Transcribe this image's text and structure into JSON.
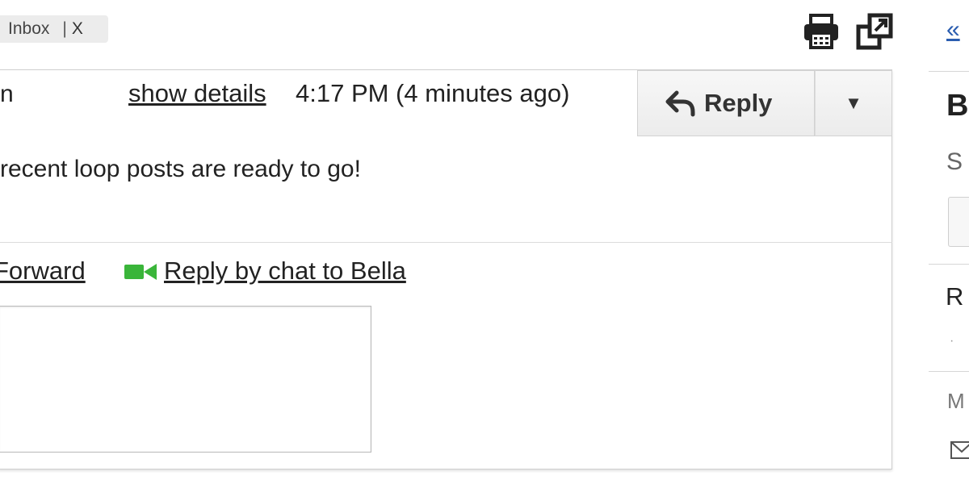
{
  "label": {
    "name": "Inbox",
    "separator": "|",
    "remove": "X"
  },
  "toolbar": {
    "print_icon": "printer-icon",
    "new_window_icon": "new-window-icon",
    "back_link": "«"
  },
  "message": {
    "sender_fragment": "n",
    "show_details": "show details",
    "timestamp": "4:17 PM (4 minutes ago)",
    "reply_label": "Reply",
    "more_icon": "▼",
    "body": "recent loop posts are ready to go!",
    "forward_label": "Forward",
    "reply_chat_label": "Reply by chat to Bella",
    "reply_box_value": ""
  },
  "side_panel": {
    "heading_fragment": "B",
    "sub_fragment": "S",
    "row_fragment": "R",
    "dot": "·",
    "meta_fragment": "M"
  },
  "colors": {
    "video_green": "#3ab53a",
    "link_blue": "#2a5db0",
    "button_bg": "#f1f1f1"
  }
}
